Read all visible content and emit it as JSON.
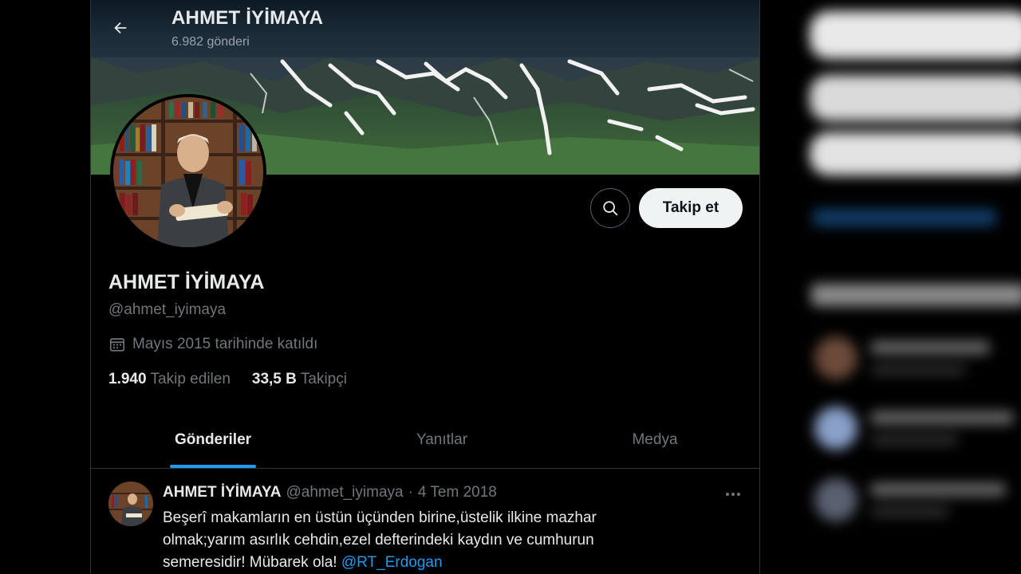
{
  "header": {
    "title": "AHMET İYİMAYA",
    "post_count": "6.982 gönderi",
    "back_label": "Geri"
  },
  "actions": {
    "follow_label": "Takip et"
  },
  "profile": {
    "name": "AHMET İYİMAYA",
    "handle": "@ahmet_iyimaya",
    "joined": "Mayıs 2015 tarihinde katıldı",
    "following_count": "1.940",
    "following_label": "Takip edilen",
    "followers_count": "33,5 B",
    "followers_label": "Takipçi"
  },
  "tabs": [
    {
      "label": "Gönderiler",
      "active": true
    },
    {
      "label": "Yanıtlar",
      "active": false
    },
    {
      "label": "Medya",
      "active": false
    }
  ],
  "post": {
    "author": "AHMET İYİMAYA",
    "handle": "@ahmet_iyimaya",
    "separator": "·",
    "date": "4 Tem 2018",
    "text_line1": "Beşerî makamların en üstün üçünden birine,üstelik ilkine mazhar",
    "text_line2": "olmak;yarım asırlık cehdin,ezel defterindeki kaydın ve cumhurun",
    "text_line3": "semeresidir! Mübarek ola! ",
    "mention": "@RT_Erdogan"
  },
  "colors": {
    "accent": "#1d9bf0",
    "background": "#000000",
    "text_primary": "#e7e9ea",
    "text_secondary": "#71767b",
    "border": "#2f3336",
    "follow_button_bg": "#eff3f4"
  },
  "icons": {
    "back": "arrow-left-icon",
    "search": "search-icon",
    "calendar": "calendar-icon",
    "more": "more-horizontal-icon"
  }
}
